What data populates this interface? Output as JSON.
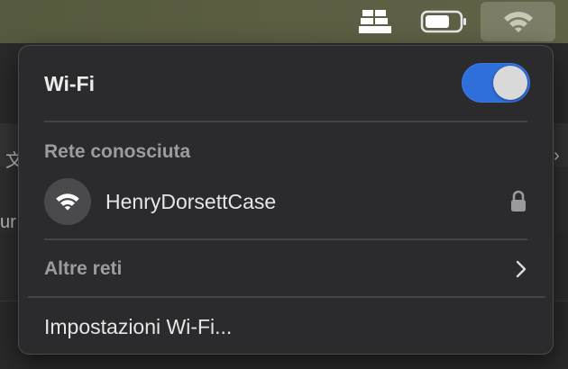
{
  "menubar": {
    "icons": [
      "database-icon",
      "battery-icon",
      "wifi-icon"
    ]
  },
  "background": {
    "fragment_1": "文",
    "fragment_2": "ur"
  },
  "wifi_menu": {
    "title": "Wi-Fi",
    "toggle_on": true,
    "known_network_header": "Rete conosciuta",
    "known_network": {
      "name": "HenryDorsettCase",
      "icon": "wifi-icon",
      "secured_icon": "lock-icon"
    },
    "other_networks_label": "Altre reti",
    "other_networks_icon": "chevron-right-icon",
    "settings_label": "Impostazioni Wi-Fi..."
  },
  "colors": {
    "toggle_accent": "#2f6fd9",
    "menu_background": "#2b2b2d"
  }
}
